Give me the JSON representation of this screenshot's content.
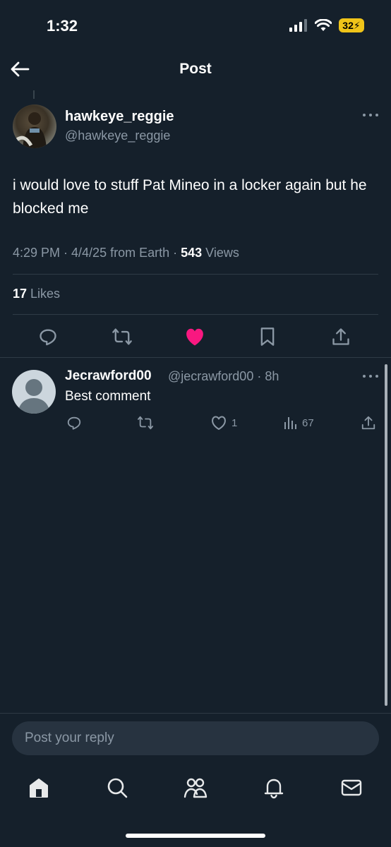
{
  "status_bar": {
    "time": "1:32",
    "battery": "32"
  },
  "header": {
    "title": "Post"
  },
  "post": {
    "author_name": "hawkeye_reggie",
    "author_handle": "@hawkeye_reggie",
    "text": "i would love to stuff Pat Mineo in a locker again but he blocked me",
    "meta_time": "4:29 PM · 4/4/25 from Earth · ",
    "views_count": "543",
    "views_label": " Views",
    "likes_count": "17",
    "likes_label": " Likes",
    "liked": true
  },
  "reply": {
    "name": "Jecrawford00",
    "handle": "@jecrawford00 · 8h",
    "text": "Best comment",
    "like_count": "1",
    "view_count": "67"
  },
  "composer": {
    "placeholder": "Post your reply"
  },
  "tabs": [
    "home-icon",
    "search-icon",
    "communities-icon",
    "notifications-icon",
    "messages-icon"
  ],
  "colors": {
    "background": "#15202b",
    "like": "#f91880",
    "muted": "#8b98a5"
  }
}
